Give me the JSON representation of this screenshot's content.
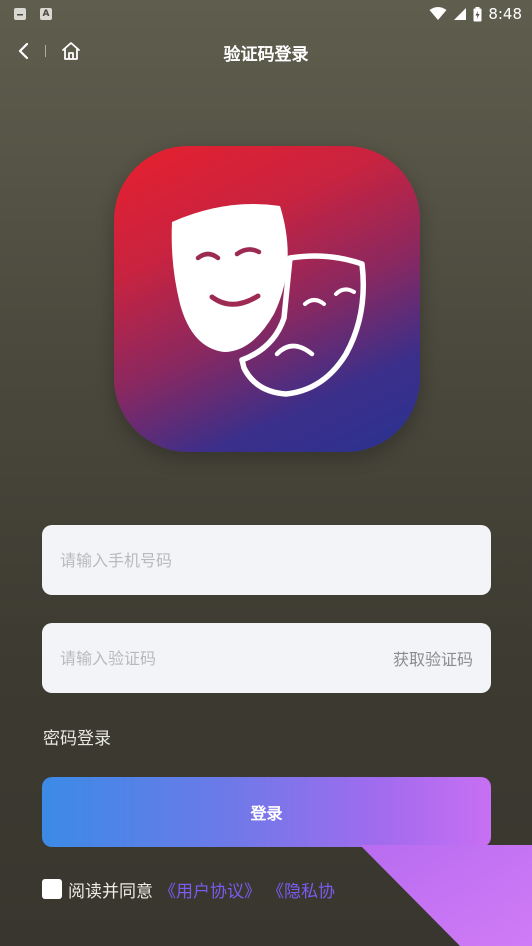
{
  "status_bar": {
    "time": "8:48",
    "left_icons": [
      "mail-icon",
      "a-icon"
    ],
    "right_icons": [
      "wifi-icon",
      "signal-icon",
      "battery-icon"
    ]
  },
  "nav": {
    "title": "验证码登录",
    "back_icon": "chevron-left-icon",
    "home_icon": "home-icon"
  },
  "app_icon": {
    "icon": "theater-masks-icon",
    "gradient_colors": [
      "#e8202e",
      "#2a3290"
    ]
  },
  "phone_field": {
    "value": "",
    "placeholder": "请输入手机号码"
  },
  "code_field": {
    "value": "",
    "placeholder": "请输入验证码",
    "get_code_label": "获取验证码"
  },
  "password_login_label": "密码登录",
  "login_button": {
    "label": "登录"
  },
  "agreement": {
    "checked": false,
    "prefix": "阅读并同意",
    "user_agreement": "《用户协议》",
    "privacy_policy": "《隐私协"
  },
  "colors": {
    "link": "#7a5cf0",
    "button_gradient_start": "#3b8be6",
    "button_gradient_end": "#c86ff3",
    "field_background": "#f3f4f7"
  }
}
